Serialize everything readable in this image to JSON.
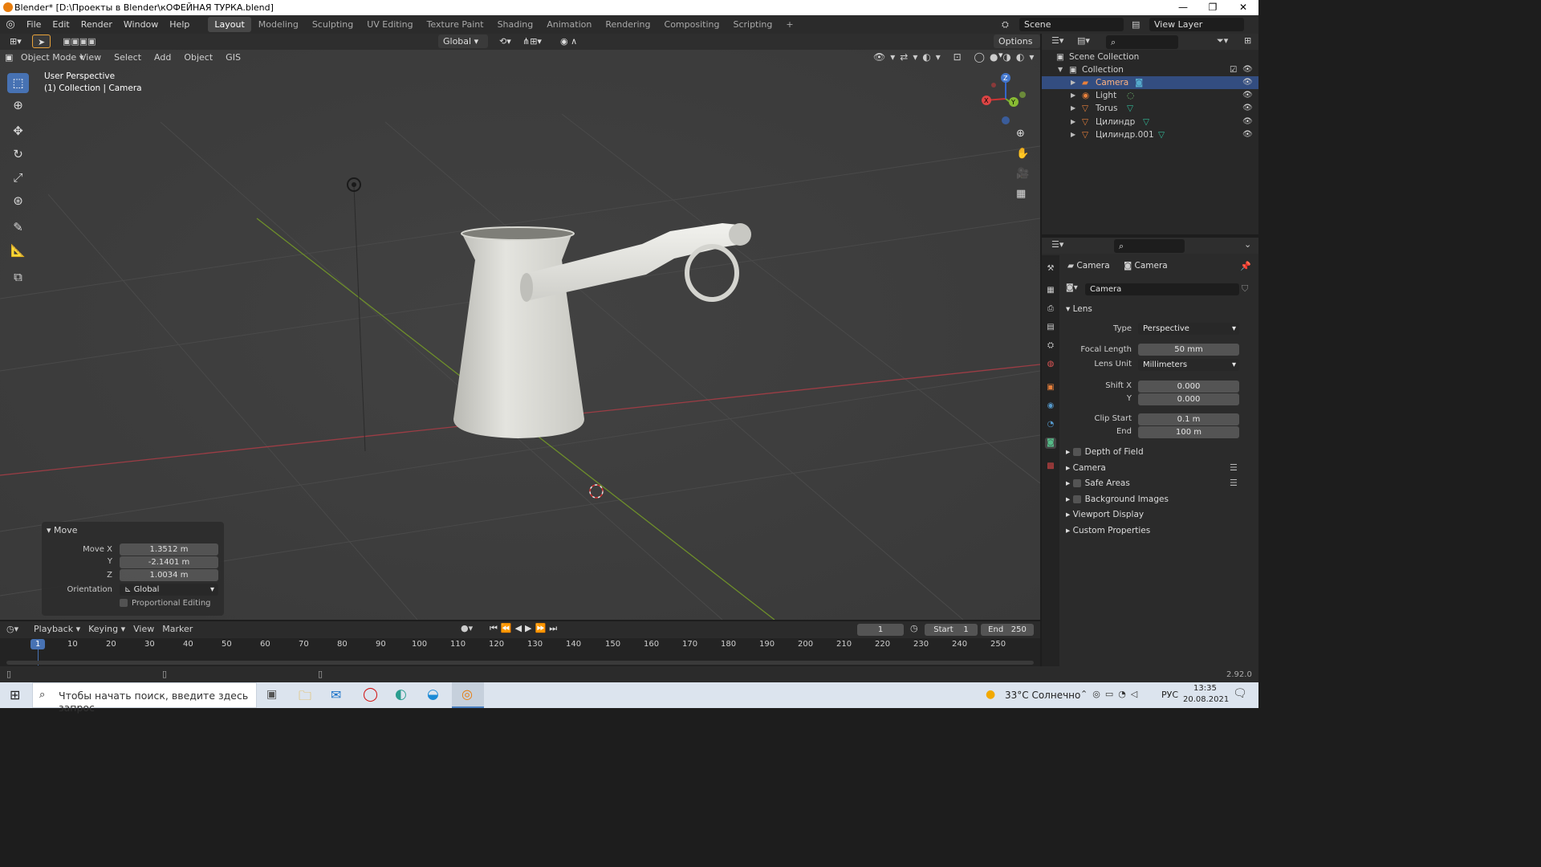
{
  "window": {
    "title": "Blender* [D:\\Проекты в Blender\\кОФЕЙНАЯ ТУРКА.blend]",
    "controls": [
      "—",
      "❐",
      "✕"
    ]
  },
  "menubar": {
    "menus": [
      "File",
      "Edit",
      "Render",
      "Window",
      "Help"
    ],
    "workspaces": [
      "Layout",
      "Modeling",
      "Sculpting",
      "UV Editing",
      "Texture Paint",
      "Shading",
      "Animation",
      "Rendering",
      "Compositing",
      "Scripting"
    ],
    "add_tab": "+",
    "scene": "Scene",
    "view_layer": "View Layer"
  },
  "viewport_header": {
    "orientation": "Global",
    "options": "Options",
    "mode": "Object Mode",
    "menus": [
      "View",
      "Select",
      "Add",
      "Object",
      "GIS"
    ]
  },
  "viewport": {
    "overlay_line1": "User Perspective",
    "overlay_line2": "(1) Collection | Camera",
    "gizmo_axes": {
      "x": "X",
      "y": "Y",
      "z": "Z"
    }
  },
  "move_panel": {
    "title": "Move",
    "rows": [
      {
        "label": "Move X",
        "value": "1.3512 m"
      },
      {
        "label": "Y",
        "value": "-2.1401 m"
      },
      {
        "label": "Z",
        "value": "1.0034 m"
      }
    ],
    "orientation_label": "Orientation",
    "orientation_value": "Global",
    "proportional": "Proportional Editing"
  },
  "outliner": {
    "scene_collection": "Scene Collection",
    "collection": "Collection",
    "items": [
      {
        "name": "Camera",
        "selected": true,
        "color": "#e8803b"
      },
      {
        "name": "Light",
        "selected": false,
        "color": "#e8803b"
      },
      {
        "name": "Torus",
        "selected": false,
        "color": "#e8803b"
      },
      {
        "name": "Цилиндр",
        "selected": false,
        "color": "#e8803b"
      },
      {
        "name": "Цилиндр.001",
        "selected": false,
        "color": "#e8803b"
      }
    ]
  },
  "properties": {
    "breadcrumb_obj": "Camera",
    "breadcrumb_data": "Camera",
    "datablock": "Camera",
    "section_lens": "Lens",
    "type_label": "Type",
    "type_value": "Perspective",
    "focal_label": "Focal Length",
    "focal_value": "50 mm",
    "lens_unit_label": "Lens Unit",
    "lens_unit_value": "Millimeters",
    "shift_x_label": "Shift X",
    "shift_x_value": "0.000",
    "shift_y_label": "Y",
    "shift_y_value": "0.000",
    "clip_start_label": "Clip Start",
    "clip_start_value": "0.1 m",
    "clip_end_label": "End",
    "clip_end_value": "100 m",
    "sections": [
      "Depth of Field",
      "Camera",
      "Safe Areas",
      "Background Images",
      "Viewport Display",
      "Custom Properties"
    ]
  },
  "timeline": {
    "menus": [
      "Playback",
      "Keying",
      "View",
      "Marker"
    ],
    "current_frame": "1",
    "start_label": "Start",
    "start_value": "1",
    "end_label": "End",
    "end_value": "250",
    "ticks": [
      "1",
      "10",
      "20",
      "30",
      "40",
      "50",
      "60",
      "70",
      "80",
      "90",
      "100",
      "110",
      "120",
      "130",
      "140",
      "150",
      "160",
      "170",
      "180",
      "190",
      "200",
      "210",
      "220",
      "230",
      "240",
      "250"
    ]
  },
  "statusbar": {
    "version": "2.92.0"
  },
  "taskbar": {
    "search_placeholder": "Чтобы начать поиск, введите здесь запрос",
    "weather": "33°C Солнечно",
    "lang": "РУС",
    "time": "13:35",
    "date": "20.08.2021"
  }
}
